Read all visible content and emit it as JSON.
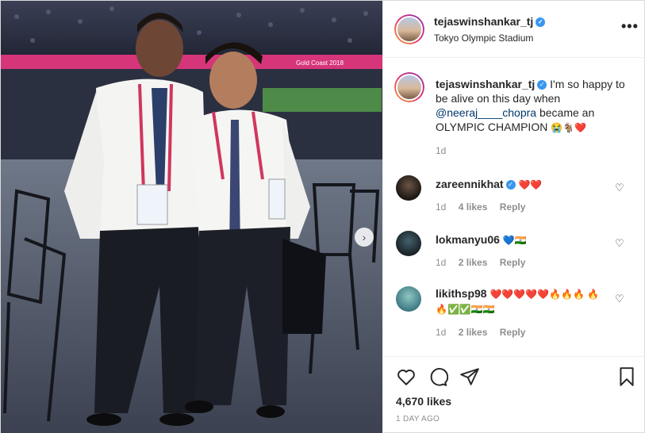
{
  "post": {
    "author": "tejaswinshankar_tj",
    "location": "Tokyo Olympic Stadium",
    "verified_icon": "verified-badge-icon",
    "more_label": "•••"
  },
  "caption": {
    "author": "tejaswinshankar_tj",
    "text_before": "I'm so happy to be alive on this day when",
    "mention": "@neeraj____chopra",
    "text_after": "became an OLYMPIC CHAMPION",
    "emojis": "😭🐐❤️",
    "time": "1d"
  },
  "comments": [
    {
      "author": "zareennikhat",
      "verified": true,
      "text": "❤️❤️",
      "time": "1d",
      "likes": "4 likes",
      "reply": "Reply"
    },
    {
      "author": "lokmanyu06",
      "verified": false,
      "text": "💙🇮🇳",
      "time": "1d",
      "likes": "2 likes",
      "reply": "Reply"
    },
    {
      "author": "likithsp98",
      "verified": false,
      "text": "❤️❤️❤️❤️❤️🔥🔥🔥 🔥🔥✅✅🇮🇳🇮🇳",
      "time": "1d",
      "likes": "2 likes",
      "reply": "Reply"
    }
  ],
  "stats": {
    "likes": "4,670 likes",
    "time_ago": "1 DAY AGO"
  },
  "photo": {
    "banner_text": "Gold Coast 2018"
  }
}
